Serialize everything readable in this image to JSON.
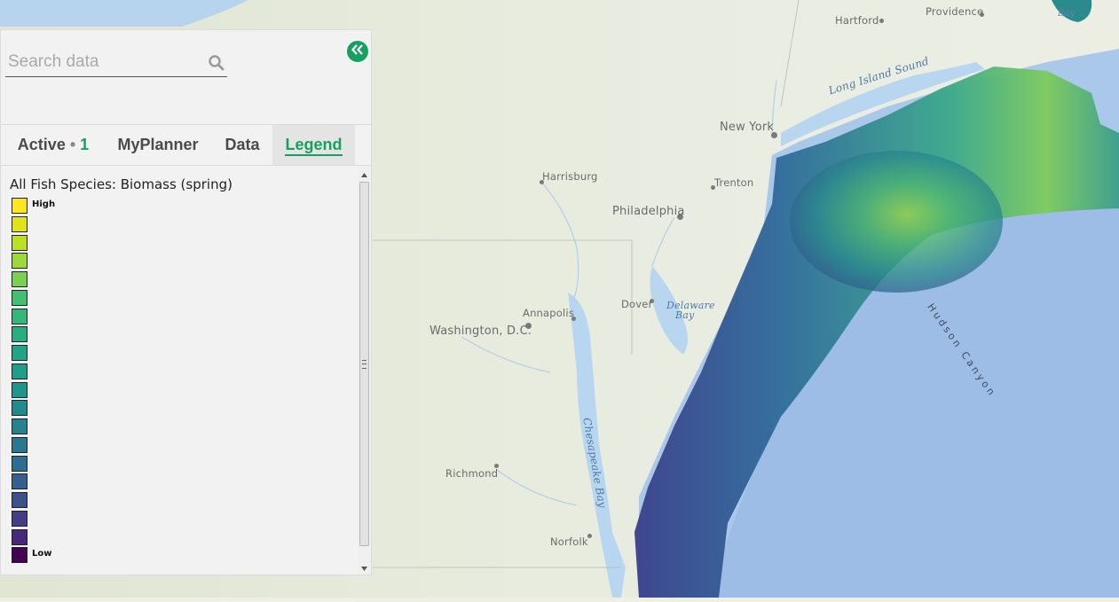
{
  "search": {
    "placeholder": "Search data",
    "value": ""
  },
  "collapse_button": {
    "icon": "double-chevron-left-icon"
  },
  "tabs": [
    {
      "label": "Active",
      "separator": "•",
      "count": "1",
      "active": false
    },
    {
      "label": "MyPlanner",
      "active": false
    },
    {
      "label": "Data",
      "active": false
    },
    {
      "label": "Legend",
      "active": true
    }
  ],
  "legend": {
    "title": "All Fish Species: Biomass (spring)",
    "high_label": "High",
    "low_label": "Low",
    "swatches": [
      "#fde725",
      "#dfe318",
      "#bddf26",
      "#9bd93c",
      "#7ad151",
      "#5ec962",
      "#44bf70",
      "#35b779",
      "#28ae80",
      "#21a585",
      "#1f9e89",
      "#1f958b",
      "#228c8d",
      "#26828e",
      "#2a788e",
      "#2e6e8e",
      "#31668e",
      "#355f8d",
      "#3b528b",
      "#433e85",
      "#482878",
      "#440154"
    ]
  },
  "colors": {
    "accent": "#17a160",
    "panel_bg": "#f2f2f2"
  },
  "map": {
    "labels": [
      {
        "text": "Hartford",
        "kind": "city"
      },
      {
        "text": "Providence",
        "kind": "city"
      },
      {
        "text": "Long Island Sound",
        "kind": "water"
      },
      {
        "text": "New York",
        "kind": "city"
      },
      {
        "text": "Harrisburg",
        "kind": "city"
      },
      {
        "text": "Trenton",
        "kind": "city"
      },
      {
        "text": "Philadelphia",
        "kind": "city"
      },
      {
        "text": "Annapolis",
        "kind": "city"
      },
      {
        "text": "Dover",
        "kind": "city"
      },
      {
        "text": "Delaware",
        "kind": "water"
      },
      {
        "text": "Bay",
        "kind": "water"
      },
      {
        "text": "Washington, D.C.",
        "kind": "city"
      },
      {
        "text": "Chesapeake Bay",
        "kind": "water"
      },
      {
        "text": "Richmond",
        "kind": "city"
      },
      {
        "text": "Norfolk",
        "kind": "city"
      },
      {
        "text": "Hudson Canyon",
        "kind": "feature"
      },
      {
        "text": "Cape Cod Bay",
        "kind": "water"
      }
    ]
  }
}
